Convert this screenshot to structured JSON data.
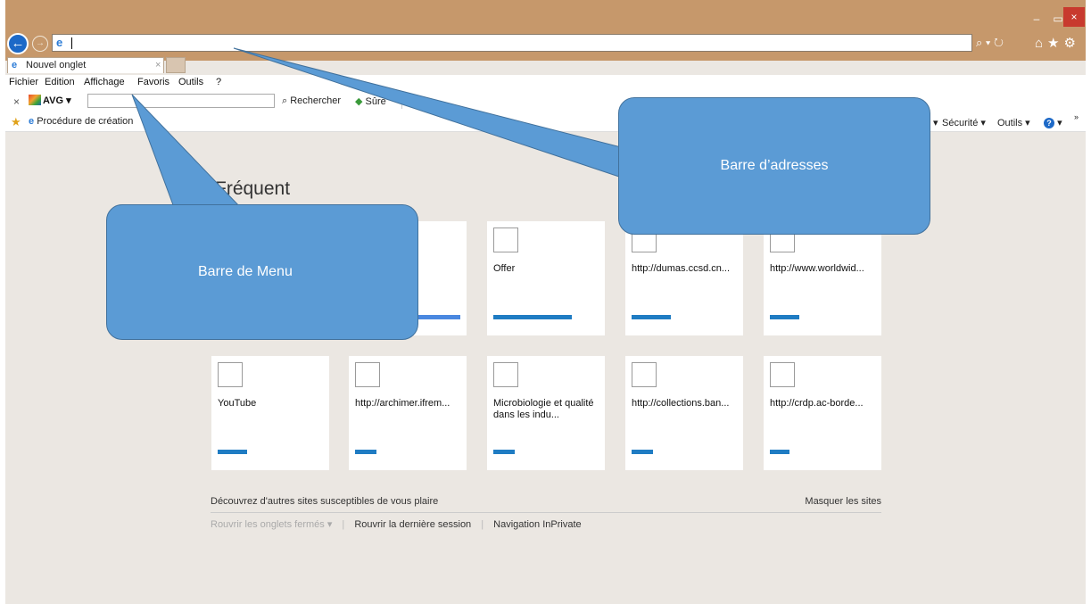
{
  "browser": {
    "window_controls": [
      "–",
      "▭",
      "×"
    ],
    "address_value": "",
    "address_tools": "⌕ ▾ ↻",
    "right_icons": "⌂★⚙",
    "tab": {
      "label": "Nouvel onglet",
      "close": "×"
    }
  },
  "menu": {
    "items": [
      "Fichier",
      "Edition",
      "Affichage",
      "Favoris",
      "Outils",
      "?"
    ]
  },
  "avg_toolbar": {
    "close": "×",
    "brand": "AVG",
    "search_placeholder": "",
    "search_label": "Rechercher",
    "safe_label": "Sûre"
  },
  "favorites_bar": {
    "item": "Procédure de création",
    "commands": [
      "▾",
      "Sécurité ▾",
      "Outils ▾",
      "▾"
    ],
    "more": "»"
  },
  "frequent": {
    "title": "Fréquent",
    "tiles": [
      {
        "label": ""
      },
      {
        "label": "Offer"
      },
      {
        "label": "http://dumas.ccsd.cn..."
      },
      {
        "label": "http://www.worldwid..."
      },
      {
        "label": "YouTube"
      },
      {
        "label": "http://archimer.ifrem..."
      },
      {
        "label": "Microbiologie et qualité dans les indu..."
      },
      {
        "label": "http://collections.ban..."
      },
      {
        "label": "http://crdp.ac-borde..."
      }
    ]
  },
  "footer": {
    "discover": "Découvrez d'autres sites susceptibles de vous plaire",
    "hide_sites": "Masquer les sites",
    "reopen_closed": "Rouvrir les onglets fermés ▾",
    "sep1": "|",
    "reopen_session": "Rouvrir la dernière session",
    "sep2": "|",
    "inprivate": "Navigation InPrivate"
  },
  "annotations": {
    "address_bar_label": "Barre d’adresses",
    "menu_bar_label": "Barre de Menu"
  },
  "colors": {
    "frame": "#c6986b",
    "content_bg": "#ebe7e2",
    "callout": "#5b9bd5",
    "tile_bar": "#1f7cc3"
  }
}
